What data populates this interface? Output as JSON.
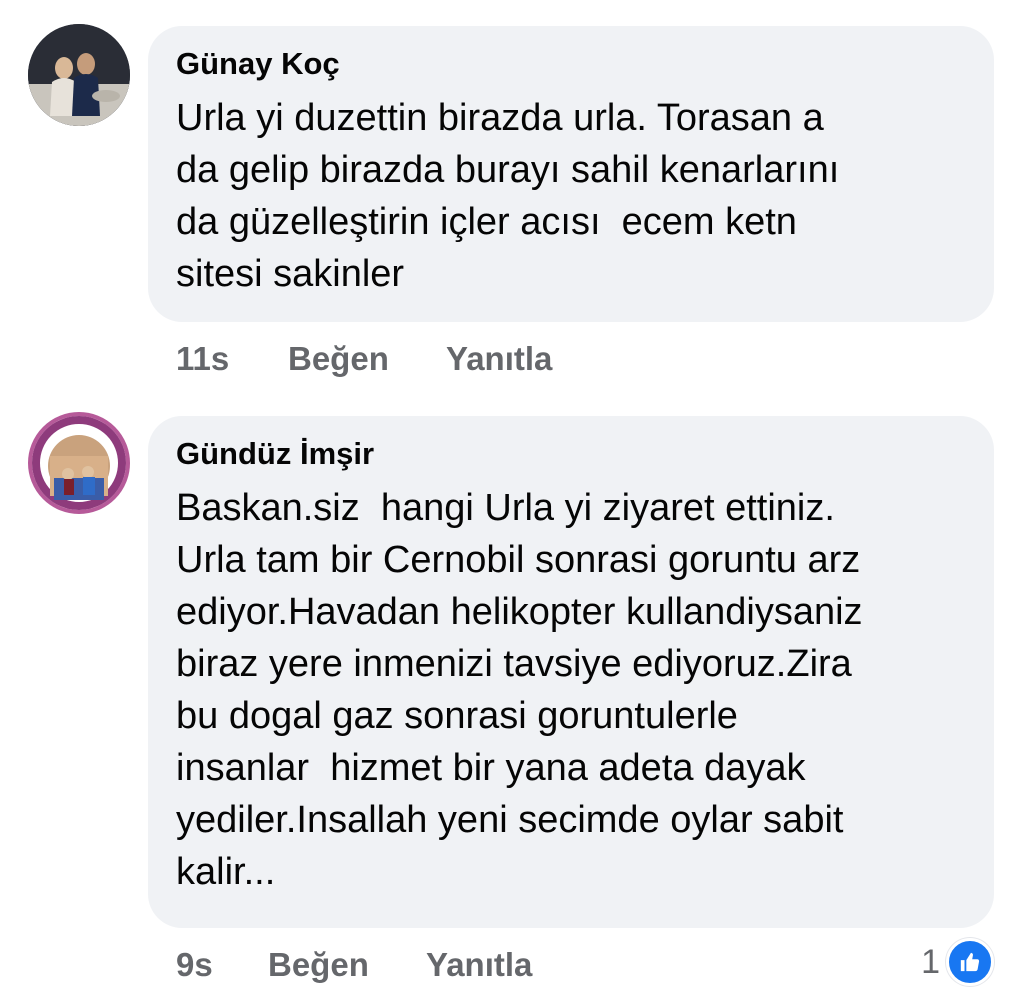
{
  "comments": [
    {
      "author": "Günay Koç",
      "text": "Urla yi duzettin birazda urla. Torasan a\nda gelip birazda burayı sahil kenarlarını\nda güzelleştirin içler acısı  ecem ketn\nsitesi sakinler",
      "time": "11s",
      "like_label": "Beğen",
      "reply_label": "Yanıtla"
    },
    {
      "author": "Gündüz İmşir",
      "text": "Baskan.siz  hangi Urla yi ziyaret ettiniz.\nUrla tam bir Cernobil sonrasi goruntu arz\nediyor.Havadan helikopter kullandiysaniz\nbiraz yere inmenizi tavsiye ediyoruz.Zira\nbu dogal gaz sonrasi goruntulerle\ninsanlar  hizmet bir yana adeta dayak\nyediler.Insallah yeni secimde oylar sabit\nkalir...",
      "time": "9s",
      "like_label": "Beğen",
      "reply_label": "Yanıtla",
      "reaction_count": "1",
      "reaction_icon": "like-icon"
    }
  ],
  "colors": {
    "bubble": "#f0f2f5",
    "meta": "#65676b",
    "like_blue": "#1877f2"
  }
}
